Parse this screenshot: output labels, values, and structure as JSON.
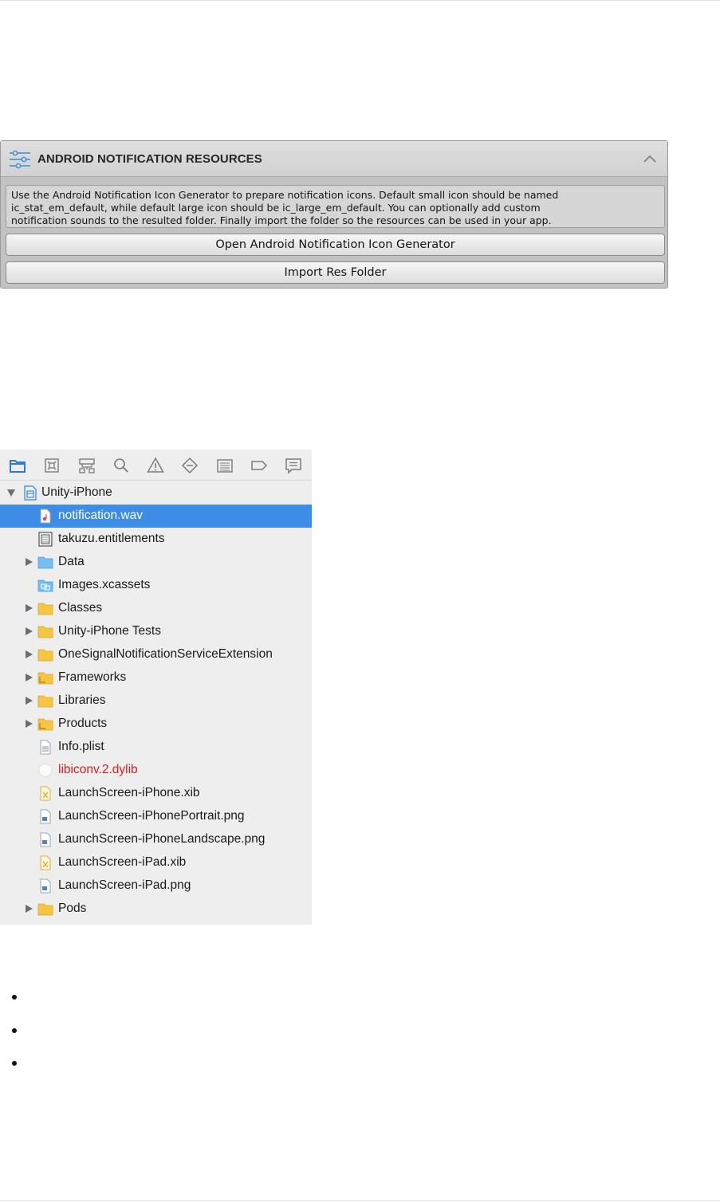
{
  "unity_panel": {
    "title": "ANDROID NOTIFICATION RESOURCES",
    "help_text": "Use the Android Notification Icon Generator to prepare notification icons. Default small icon should be named\nic_stat_em_default, while default large icon should be ic_large_em_default. You can optionally add custom\nnotification sounds to the resulted folder. Finally import the folder so the resources can be used in your app.",
    "open_generator_button": "Open Android Notification Icon Generator",
    "import_button": "Import Res Folder",
    "accent_color": "#3a8ad8"
  },
  "xcode_navigator": {
    "toolbar_icons": [
      "project-navigator-icon",
      "source-control-icon",
      "symbol-navigator-icon",
      "find-icon",
      "issue-icon",
      "test-icon",
      "debug-icon",
      "breakpoint-icon",
      "report-icon"
    ],
    "project": "Unity-iPhone",
    "selected_color": "#3d8ce6",
    "items": [
      {
        "label": "notification.wav",
        "icon": "audio-file-icon",
        "selected": true
      },
      {
        "label": "takuzu.entitlements",
        "icon": "entitlements-file-icon"
      },
      {
        "label": "Data",
        "icon": "blue-folder-icon",
        "expandable": true
      },
      {
        "label": "Images.xcassets",
        "icon": "asset-catalog-icon"
      },
      {
        "label": "Classes",
        "icon": "folder-icon",
        "expandable": true
      },
      {
        "label": "Unity-iPhone Tests",
        "icon": "folder-icon",
        "expandable": true
      },
      {
        "label": "OneSignalNotificationServiceExtension",
        "icon": "folder-icon",
        "expandable": true
      },
      {
        "label": "Frameworks",
        "icon": "folder-icon",
        "expandable": true
      },
      {
        "label": "Libraries",
        "icon": "folder-icon",
        "expandable": true
      },
      {
        "label": "Products",
        "icon": "folder-icon",
        "expandable": true
      },
      {
        "label": "Info.plist",
        "icon": "plist-file-icon"
      },
      {
        "label": "libiconv.2.dylib",
        "icon": "library-file-icon",
        "missing": true
      },
      {
        "label": "LaunchScreen-iPhone.xib",
        "icon": "xib-file-icon"
      },
      {
        "label": "LaunchScreen-iPhonePortrait.png",
        "icon": "png-file-icon"
      },
      {
        "label": "LaunchScreen-iPhoneLandscape.png",
        "icon": "png-file-icon"
      },
      {
        "label": "LaunchScreen-iPad.xib",
        "icon": "xib-file-icon"
      },
      {
        "label": "LaunchScreen-iPad.png",
        "icon": "png-file-icon"
      },
      {
        "label": "Pods",
        "icon": "folder-icon",
        "expandable": true
      }
    ]
  },
  "bullets": [
    "",
    "",
    ""
  ]
}
